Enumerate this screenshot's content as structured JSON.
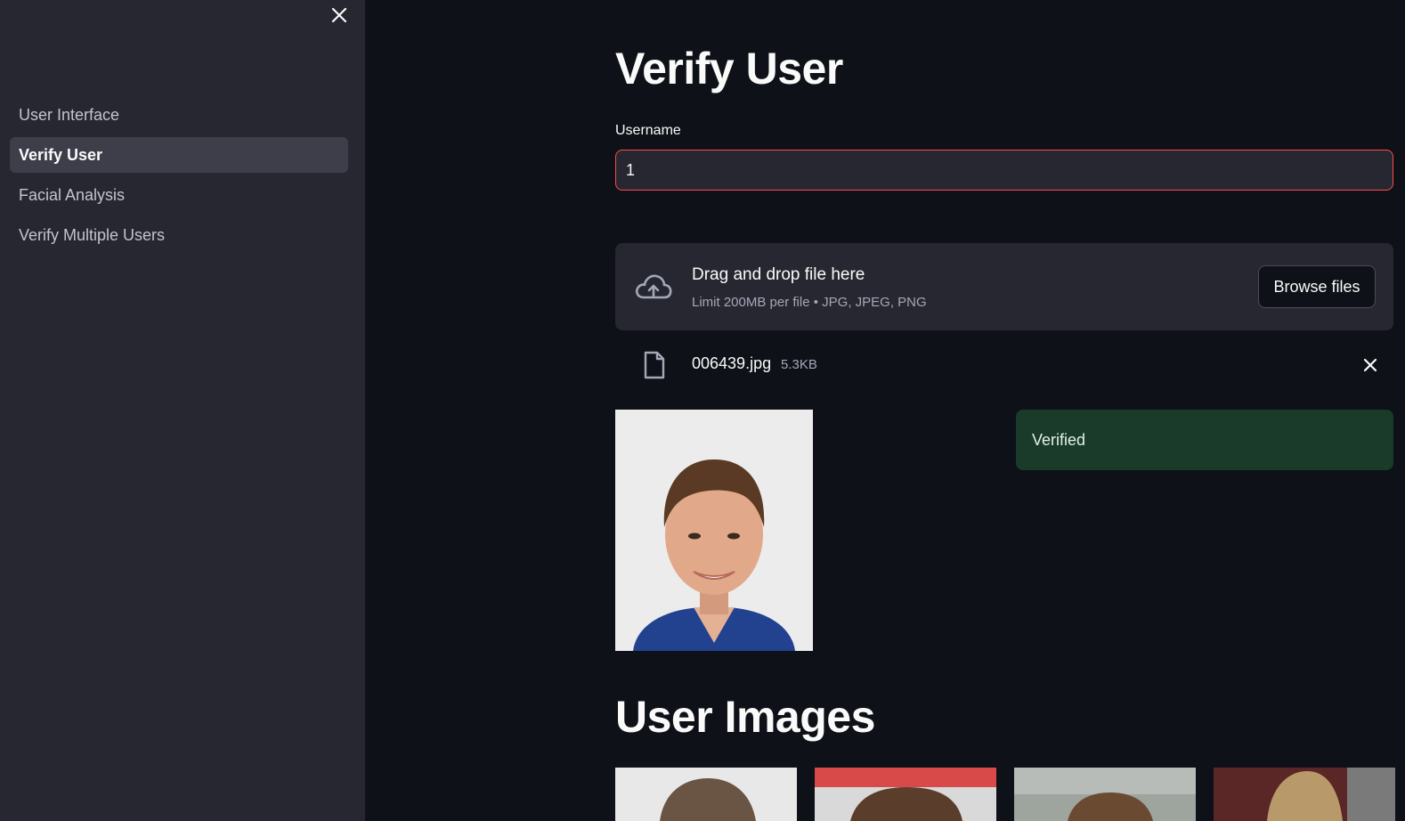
{
  "sidebar": {
    "items": [
      {
        "label": "User Interface",
        "active": false
      },
      {
        "label": "Verify User",
        "active": true
      },
      {
        "label": "Facial Analysis",
        "active": false
      },
      {
        "label": "Verify Multiple Users",
        "active": false
      }
    ]
  },
  "main": {
    "title": "Verify User",
    "username": {
      "label": "Username",
      "value": "1"
    },
    "uploader": {
      "title": "Drag and drop file here",
      "subtitle": "Limit 200MB per file • JPG, JPEG, PNG",
      "button_label": "Browse files"
    },
    "file": {
      "name": "006439.jpg",
      "size": "5.3KB"
    },
    "status_message": "Verified",
    "section_title": "User Images"
  },
  "colors": {
    "background": "#0e1117",
    "sidebar": "#262730",
    "accent_error_border": "#ff4b4b",
    "success_bg": "#1a3a2a"
  },
  "icons": [
    "close-icon",
    "cloud-upload-icon",
    "file-icon",
    "remove-file-icon"
  ]
}
